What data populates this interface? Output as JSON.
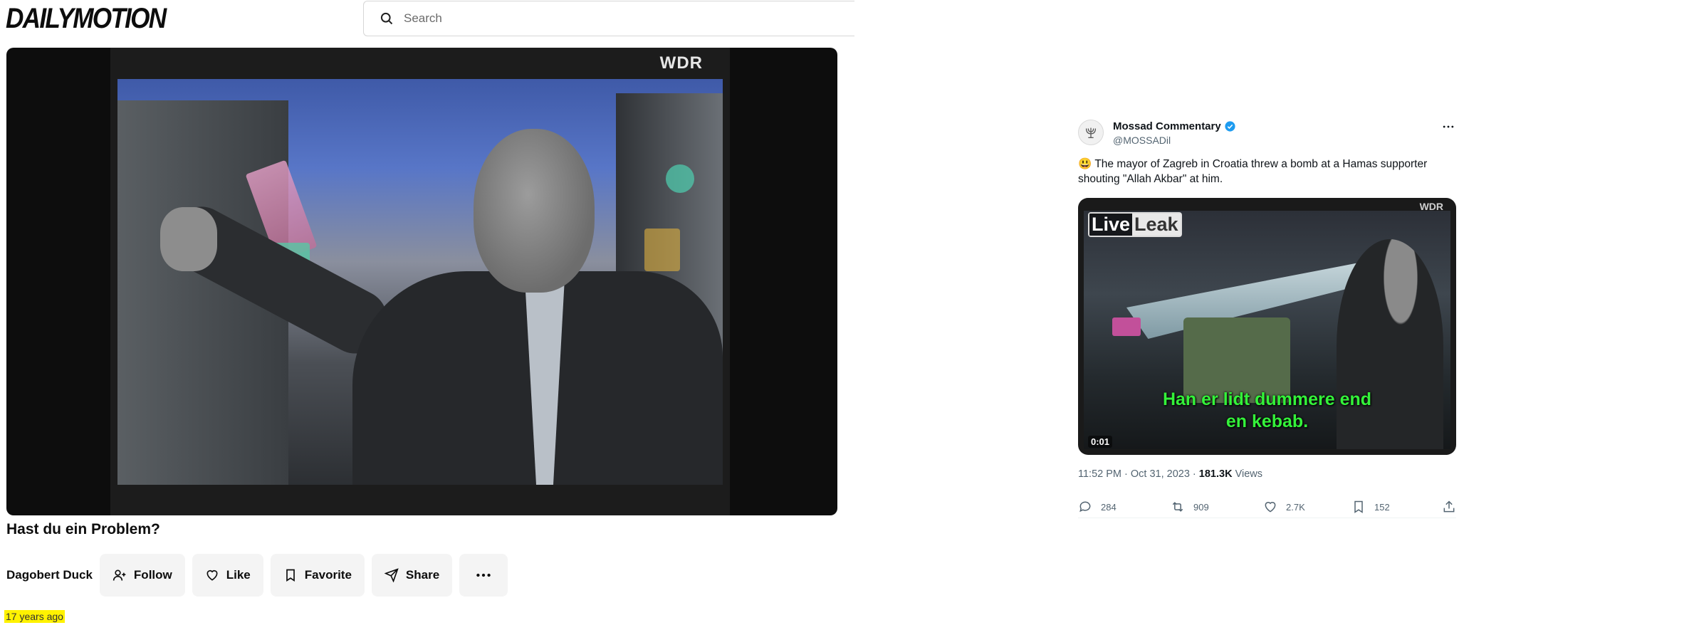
{
  "dailymotion": {
    "logo": "DAILYMOTION",
    "search": {
      "placeholder": "Search"
    },
    "video": {
      "watermark": "WDR"
    },
    "title": "Hast du ein Problem?",
    "author": "Dagobert Duck",
    "buttons": {
      "follow": "Follow",
      "like": "Like",
      "favorite": "Favorite",
      "share": "Share"
    },
    "age": "17 years ago"
  },
  "tweet": {
    "display_name": "Mossad Commentary",
    "handle": "@MOSSADil",
    "text": "😃 The mayor of Zagreb in Croatia threw a bomb at a Hamas supporter shouting \"Allah Akbar\" at him.",
    "media": {
      "liveleak_left": "Live",
      "liveleak_right": "Leak",
      "watermark": "WDR",
      "subtitle_line1": "Han er lidt dummere end",
      "subtitle_line2": "en kebab.",
      "timestamp": "0:01"
    },
    "time": "11:52 PM · Oct 31, 2023 · ",
    "views_count": "181.3K",
    "views_label": " Views",
    "stats": {
      "replies": "284",
      "retweets": "909",
      "likes": "2.7K",
      "bookmarks": "152"
    },
    "colors": {
      "verified": "#1d9bf0",
      "subtitle": "#34f23a"
    }
  }
}
